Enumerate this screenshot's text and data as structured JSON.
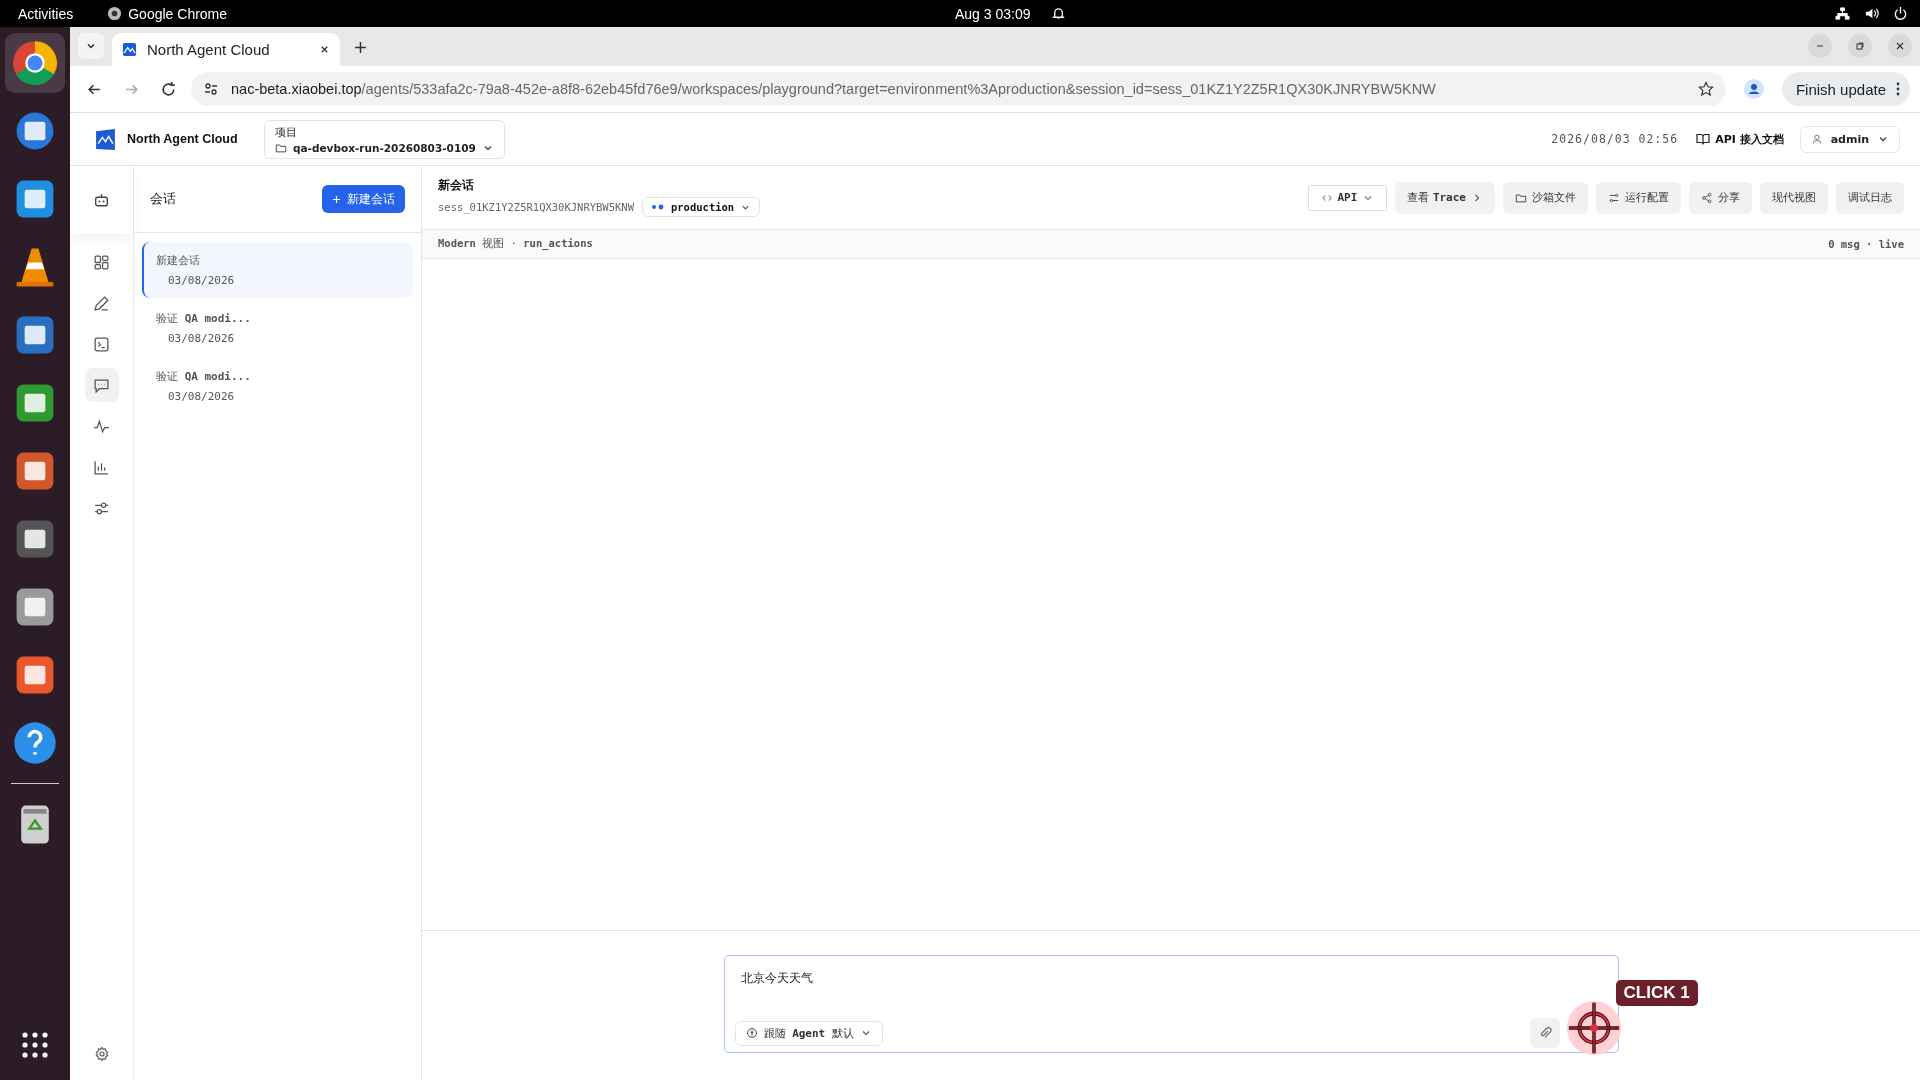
{
  "top_bar": {
    "activities": "Activities",
    "app_name": "Google Chrome",
    "clock": "Aug 3  03:09"
  },
  "dock": [
    {
      "selected": true
    },
    {
      "selected": false
    },
    {
      "selected": false
    },
    {
      "selected": false
    },
    {
      "selected": false
    },
    {
      "selected": false
    },
    {
      "selected": false
    },
    {
      "selected": false
    },
    {
      "selected": false
    },
    {
      "selected": false
    },
    {
      "selected": false
    }
  ],
  "browser": {
    "tabs": [
      {
        "title": "North Agent Cloud",
        "selected": true
      }
    ],
    "url_host": "nac-beta.xiaobei.top",
    "url_path": "/agents/533afa2c-79a8-452e-a8f8-62eb45fd76e9/workspaces/playground?target=environment%3Aproduction&session_id=sess_01KZ1Y2Z5R1QX30KJNRYBW5KNW",
    "update_button": "Finish update"
  },
  "header": {
    "brand": "North Agent Cloud",
    "project_label": "项目",
    "project": "qa-devbox-run-20260803-0109",
    "datetime": "2026/08/03 02:56",
    "docs_link": "API 接入文档",
    "user": "admin"
  },
  "rail": [
    {
      "selected": false
    },
    {
      "selected": false
    },
    {
      "selected": false
    },
    {
      "selected": false
    },
    {
      "selected": true
    },
    {
      "selected": false
    },
    {
      "selected": false
    },
    {
      "selected": false
    }
  ],
  "sessions": {
    "title": "会话",
    "new_button": "新建会话",
    "items": [
      {
        "title": "新建会话",
        "date": "03/08/2026",
        "selected": true
      },
      {
        "title": "验证 **QA modi...**",
        "date": "03/08/2026",
        "selected": false
      },
      {
        "title": "验证 **QA modi...**",
        "date": "03/08/2026",
        "selected": false
      }
    ]
  },
  "session": {
    "title": "新会话",
    "id": "sess_01KZ1Y2Z5R1QX30KJNRYBW5KNW",
    "environment": "production",
    "toolbar": [
      "API",
      "查看 **Trace**",
      "沙箱文件",
      "运行配置",
      "分享",
      "现代视图",
      "调试日志"
    ],
    "view_info": "**Modern** 视图 · **run_actions**",
    "status": "0 msg · live"
  },
  "composer": {
    "value": "北京今天天气",
    "model": "跟随 **Agent** 默认"
  },
  "overlay": {
    "label": "CLICK 1"
  }
}
